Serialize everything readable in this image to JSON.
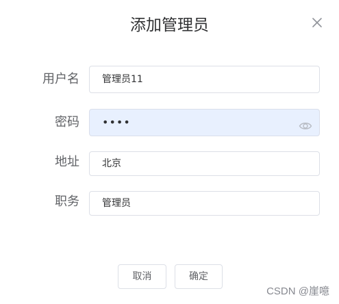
{
  "dialog": {
    "title": "添加管理员",
    "close_icon": "close-icon"
  },
  "form": {
    "username": {
      "label": "用户名",
      "value": "管理员11"
    },
    "password": {
      "label": "密码",
      "value": "••••",
      "icon": "eye-icon"
    },
    "address": {
      "label": "地址",
      "value": "北京"
    },
    "position": {
      "label": "职务",
      "value": "管理员"
    }
  },
  "footer": {
    "cancel_label": "取消",
    "confirm_label": "确定"
  },
  "watermark": "CSDN @崖噫",
  "colors": {
    "border": "#dcdfe6",
    "password_bg": "#e8f0fe",
    "text": "#606266",
    "title": "#303133"
  }
}
